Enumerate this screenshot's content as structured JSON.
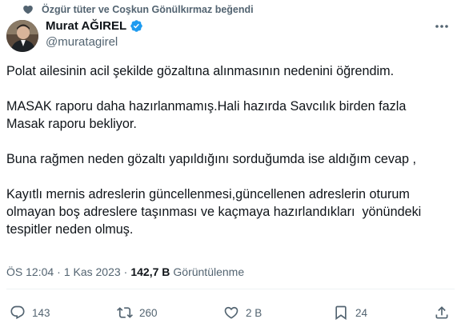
{
  "social_context": {
    "text": "Özgür tüter ve Coşkun Gönülkırmaz beğendi",
    "icon": "heart-icon"
  },
  "author": {
    "name": "Murat AĞIREL",
    "handle": "@muratagirel",
    "verified_color": "#1d9bf0"
  },
  "tweet": {
    "paragraphs": [
      [
        "Polat ailesinin acil şekilde gözaltına alınmasının nedenini öğrendim."
      ],
      [
        "MASAK raporu daha hazırlanmamış.Hali hazırda Savcılık birden fazla",
        "Masak raporu bekliyor."
      ],
      [
        "Buna rağmen neden gözaltı yapıldığını sorduğumda ise aldığım cevap ,"
      ],
      [
        "Kayıtlı mernis adreslerin güncellenmesi,güncellenen adreslerin oturum",
        "olmayan boş adreslere taşınması ve kaçmaya hazırlandıkları  yönündeki",
        "tespitler neden olmuş."
      ]
    ]
  },
  "meta": {
    "time": "ÖS 12:04",
    "sep1": "·",
    "date": "1 Kas 2023",
    "sep2": "·",
    "views_count": "142,7 B",
    "views_label": "Görüntülenme"
  },
  "actions": {
    "reply": {
      "count": "143",
      "icon": "reply-icon"
    },
    "retweet": {
      "count": "260",
      "icon": "retweet-icon"
    },
    "like": {
      "count": "2 B",
      "icon": "heart-icon"
    },
    "bookmark": {
      "count": "24",
      "icon": "bookmark-icon"
    },
    "share": {
      "icon": "share-icon"
    }
  }
}
